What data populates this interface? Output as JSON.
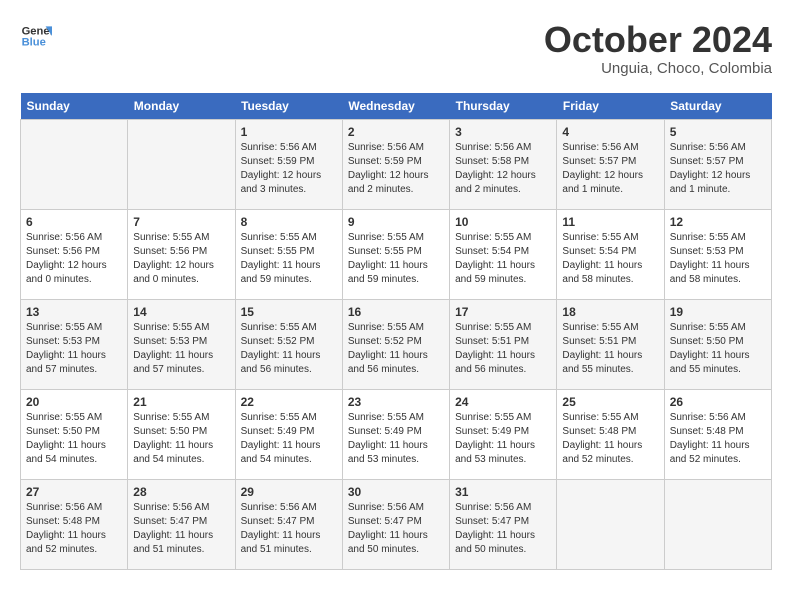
{
  "logo": {
    "line1": "General",
    "line2": "Blue"
  },
  "title": "October 2024",
  "subtitle": "Unguia, Choco, Colombia",
  "days_header": [
    "Sunday",
    "Monday",
    "Tuesday",
    "Wednesday",
    "Thursday",
    "Friday",
    "Saturday"
  ],
  "weeks": [
    [
      {
        "day": "",
        "sunrise": "",
        "sunset": "",
        "daylight": ""
      },
      {
        "day": "",
        "sunrise": "",
        "sunset": "",
        "daylight": ""
      },
      {
        "day": "1",
        "sunrise": "Sunrise: 5:56 AM",
        "sunset": "Sunset: 5:59 PM",
        "daylight": "Daylight: 12 hours and 3 minutes."
      },
      {
        "day": "2",
        "sunrise": "Sunrise: 5:56 AM",
        "sunset": "Sunset: 5:59 PM",
        "daylight": "Daylight: 12 hours and 2 minutes."
      },
      {
        "day": "3",
        "sunrise": "Sunrise: 5:56 AM",
        "sunset": "Sunset: 5:58 PM",
        "daylight": "Daylight: 12 hours and 2 minutes."
      },
      {
        "day": "4",
        "sunrise": "Sunrise: 5:56 AM",
        "sunset": "Sunset: 5:57 PM",
        "daylight": "Daylight: 12 hours and 1 minute."
      },
      {
        "day": "5",
        "sunrise": "Sunrise: 5:56 AM",
        "sunset": "Sunset: 5:57 PM",
        "daylight": "Daylight: 12 hours and 1 minute."
      }
    ],
    [
      {
        "day": "6",
        "sunrise": "Sunrise: 5:56 AM",
        "sunset": "Sunset: 5:56 PM",
        "daylight": "Daylight: 12 hours and 0 minutes."
      },
      {
        "day": "7",
        "sunrise": "Sunrise: 5:55 AM",
        "sunset": "Sunset: 5:56 PM",
        "daylight": "Daylight: 12 hours and 0 minutes."
      },
      {
        "day": "8",
        "sunrise": "Sunrise: 5:55 AM",
        "sunset": "Sunset: 5:55 PM",
        "daylight": "Daylight: 11 hours and 59 minutes."
      },
      {
        "day": "9",
        "sunrise": "Sunrise: 5:55 AM",
        "sunset": "Sunset: 5:55 PM",
        "daylight": "Daylight: 11 hours and 59 minutes."
      },
      {
        "day": "10",
        "sunrise": "Sunrise: 5:55 AM",
        "sunset": "Sunset: 5:54 PM",
        "daylight": "Daylight: 11 hours and 59 minutes."
      },
      {
        "day": "11",
        "sunrise": "Sunrise: 5:55 AM",
        "sunset": "Sunset: 5:54 PM",
        "daylight": "Daylight: 11 hours and 58 minutes."
      },
      {
        "day": "12",
        "sunrise": "Sunrise: 5:55 AM",
        "sunset": "Sunset: 5:53 PM",
        "daylight": "Daylight: 11 hours and 58 minutes."
      }
    ],
    [
      {
        "day": "13",
        "sunrise": "Sunrise: 5:55 AM",
        "sunset": "Sunset: 5:53 PM",
        "daylight": "Daylight: 11 hours and 57 minutes."
      },
      {
        "day": "14",
        "sunrise": "Sunrise: 5:55 AM",
        "sunset": "Sunset: 5:53 PM",
        "daylight": "Daylight: 11 hours and 57 minutes."
      },
      {
        "day": "15",
        "sunrise": "Sunrise: 5:55 AM",
        "sunset": "Sunset: 5:52 PM",
        "daylight": "Daylight: 11 hours and 56 minutes."
      },
      {
        "day": "16",
        "sunrise": "Sunrise: 5:55 AM",
        "sunset": "Sunset: 5:52 PM",
        "daylight": "Daylight: 11 hours and 56 minutes."
      },
      {
        "day": "17",
        "sunrise": "Sunrise: 5:55 AM",
        "sunset": "Sunset: 5:51 PM",
        "daylight": "Daylight: 11 hours and 56 minutes."
      },
      {
        "day": "18",
        "sunrise": "Sunrise: 5:55 AM",
        "sunset": "Sunset: 5:51 PM",
        "daylight": "Daylight: 11 hours and 55 minutes."
      },
      {
        "day": "19",
        "sunrise": "Sunrise: 5:55 AM",
        "sunset": "Sunset: 5:50 PM",
        "daylight": "Daylight: 11 hours and 55 minutes."
      }
    ],
    [
      {
        "day": "20",
        "sunrise": "Sunrise: 5:55 AM",
        "sunset": "Sunset: 5:50 PM",
        "daylight": "Daylight: 11 hours and 54 minutes."
      },
      {
        "day": "21",
        "sunrise": "Sunrise: 5:55 AM",
        "sunset": "Sunset: 5:50 PM",
        "daylight": "Daylight: 11 hours and 54 minutes."
      },
      {
        "day": "22",
        "sunrise": "Sunrise: 5:55 AM",
        "sunset": "Sunset: 5:49 PM",
        "daylight": "Daylight: 11 hours and 54 minutes."
      },
      {
        "day": "23",
        "sunrise": "Sunrise: 5:55 AM",
        "sunset": "Sunset: 5:49 PM",
        "daylight": "Daylight: 11 hours and 53 minutes."
      },
      {
        "day": "24",
        "sunrise": "Sunrise: 5:55 AM",
        "sunset": "Sunset: 5:49 PM",
        "daylight": "Daylight: 11 hours and 53 minutes."
      },
      {
        "day": "25",
        "sunrise": "Sunrise: 5:55 AM",
        "sunset": "Sunset: 5:48 PM",
        "daylight": "Daylight: 11 hours and 52 minutes."
      },
      {
        "day": "26",
        "sunrise": "Sunrise: 5:56 AM",
        "sunset": "Sunset: 5:48 PM",
        "daylight": "Daylight: 11 hours and 52 minutes."
      }
    ],
    [
      {
        "day": "27",
        "sunrise": "Sunrise: 5:56 AM",
        "sunset": "Sunset: 5:48 PM",
        "daylight": "Daylight: 11 hours and 52 minutes."
      },
      {
        "day": "28",
        "sunrise": "Sunrise: 5:56 AM",
        "sunset": "Sunset: 5:47 PM",
        "daylight": "Daylight: 11 hours and 51 minutes."
      },
      {
        "day": "29",
        "sunrise": "Sunrise: 5:56 AM",
        "sunset": "Sunset: 5:47 PM",
        "daylight": "Daylight: 11 hours and 51 minutes."
      },
      {
        "day": "30",
        "sunrise": "Sunrise: 5:56 AM",
        "sunset": "Sunset: 5:47 PM",
        "daylight": "Daylight: 11 hours and 50 minutes."
      },
      {
        "day": "31",
        "sunrise": "Sunrise: 5:56 AM",
        "sunset": "Sunset: 5:47 PM",
        "daylight": "Daylight: 11 hours and 50 minutes."
      },
      {
        "day": "",
        "sunrise": "",
        "sunset": "",
        "daylight": ""
      },
      {
        "day": "",
        "sunrise": "",
        "sunset": "",
        "daylight": ""
      }
    ]
  ]
}
